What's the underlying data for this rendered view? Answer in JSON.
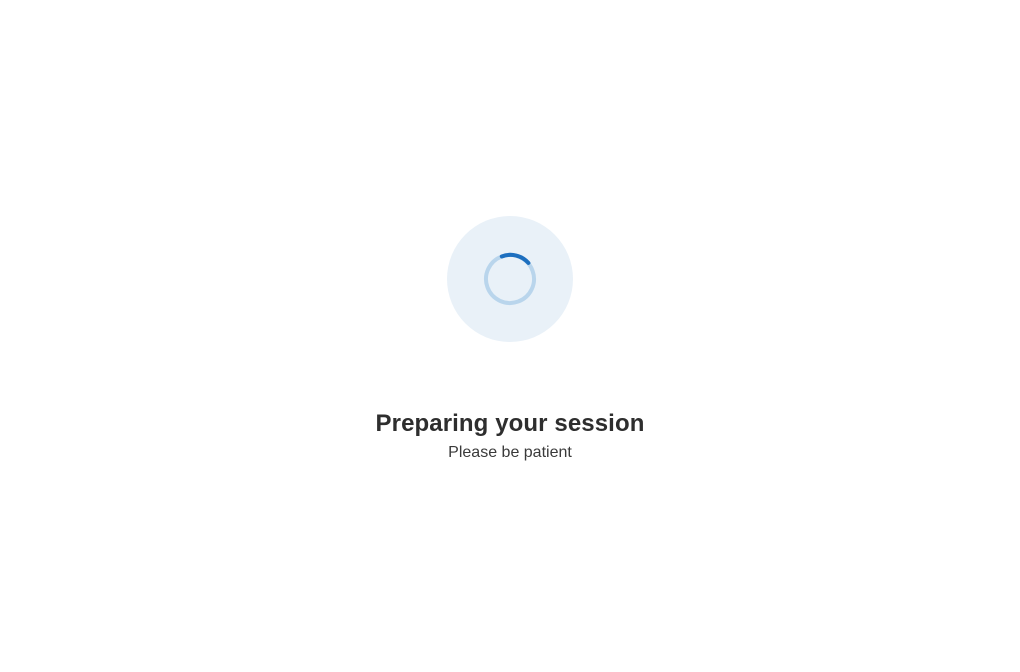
{
  "loading": {
    "heading": "Preparing your session",
    "subtext": "Please be patient"
  }
}
